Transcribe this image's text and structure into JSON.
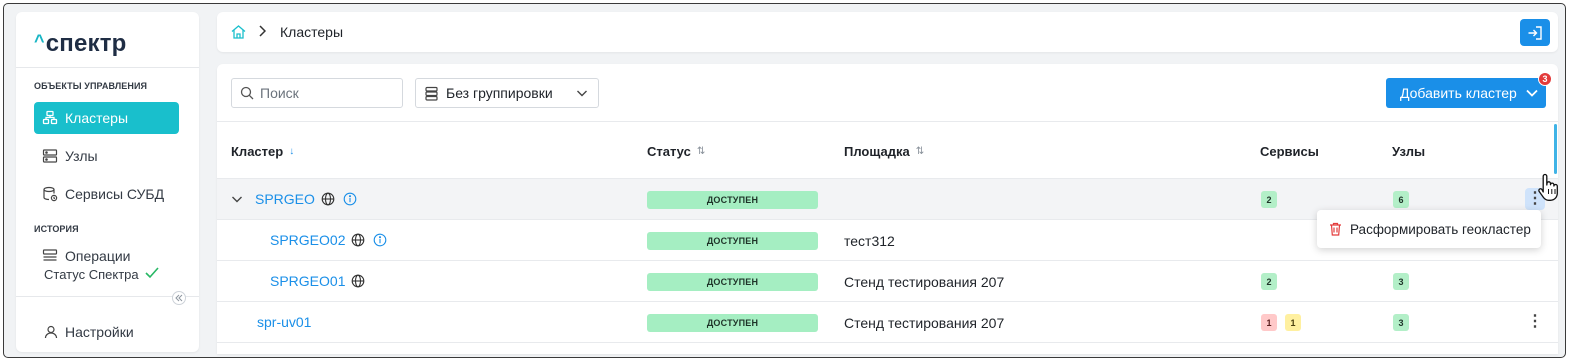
{
  "sidebar": {
    "logo_caret": "^",
    "logo_text": "спектр",
    "section_management": "ОБЪЕКТЫ УПРАВЛЕНИЯ",
    "items": [
      {
        "label": "Кластеры",
        "icon": "cluster-icon",
        "active": true
      },
      {
        "label": "Узлы",
        "icon": "server-icon",
        "active": false
      },
      {
        "label": "Сервисы СУБД",
        "icon": "database-icon",
        "active": false
      }
    ],
    "section_history": "ИСТОРИЯ",
    "history_items": [
      {
        "label": "Операции",
        "icon": "operations-icon"
      }
    ],
    "status_label": "Статус Спектра",
    "status_icon": "check-icon",
    "settings_label": "Настройки"
  },
  "header": {
    "breadcrumb_current": "Кластеры",
    "home_icon": "home-icon",
    "exit_icon": "logout-icon"
  },
  "toolbar": {
    "search_placeholder": "Поиск",
    "group_select_value": "Без группировки",
    "add_button_label": "Добавить кластер",
    "notification_count": "3"
  },
  "table": {
    "columns": [
      {
        "label": "Кластер",
        "sort": "asc"
      },
      {
        "label": "Статус",
        "sort": "both"
      },
      {
        "label": "Площадка",
        "sort": "both"
      },
      {
        "label": "Сервисы",
        "sort": ""
      },
      {
        "label": "Узлы",
        "sort": ""
      }
    ],
    "sort_icon": "↓",
    "sort_both_icon": "⇅",
    "rows": [
      {
        "name": "SPRGEO",
        "expanded": true,
        "globe": true,
        "info": true,
        "status": "ДОСТУПЕН",
        "site": "",
        "services": [
          "2"
        ],
        "nodes": "6",
        "menu_open": true
      },
      {
        "name": "SPRGEO02",
        "child": true,
        "globe": true,
        "info": true,
        "status": "ДОСТУПЕН",
        "site": "тест312",
        "services": [],
        "nodes": ""
      },
      {
        "name": "SPRGEO01",
        "child": true,
        "globe": true,
        "info": false,
        "status": "ДОСТУПЕН",
        "site": "Стенд тестирования 207",
        "services": [
          "2"
        ],
        "nodes": "3"
      },
      {
        "name": "spr-uv01",
        "child": false,
        "globe": false,
        "info": false,
        "status": "ДОСТУПЕН",
        "site": "Стенд тестирования 207",
        "services_error": "1",
        "services_warning": "1",
        "nodes": "3"
      }
    ]
  },
  "context_menu": {
    "item_label": "Расформировать геокластер",
    "item_icon": "trash-icon"
  },
  "colors": {
    "accent": "#19bfcc",
    "primary": "#1a8fe8",
    "ok_badge": "#a5eec2",
    "error": "#e33b3b"
  }
}
